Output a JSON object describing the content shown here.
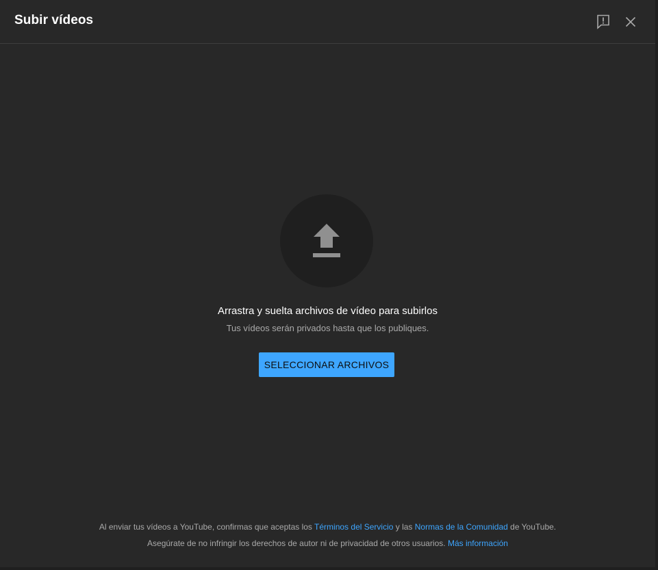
{
  "dialog": {
    "title": "Subir vídeos",
    "feedback_icon": "feedback-icon",
    "close_icon": "close-icon"
  },
  "upload": {
    "icon": "upload-arrow-icon",
    "title": "Arrastra y suelta archivos de vídeo para subirlos",
    "subtitle": "Tus vídeos serán privados hasta que los publiques.",
    "select_button": "SELECCIONAR ARCHIVOS"
  },
  "footer": {
    "line1_prefix": "Al enviar tus vídeos a YouTube, confirmas que aceptas los ",
    "terms_link": "Términos del Servicio",
    "line1_middle": " y las ",
    "community_link": "Normas de la Comunidad",
    "line1_suffix": " de YouTube.",
    "line2_text": "Asegúrate de no infringir los derechos de autor ni de privacidad de otros usuarios. ",
    "more_info_link": "Más información"
  },
  "colors": {
    "background": "#282828",
    "accent": "#3ea6ff",
    "text_primary": "#ffffff",
    "text_secondary": "#aaaaaa"
  }
}
